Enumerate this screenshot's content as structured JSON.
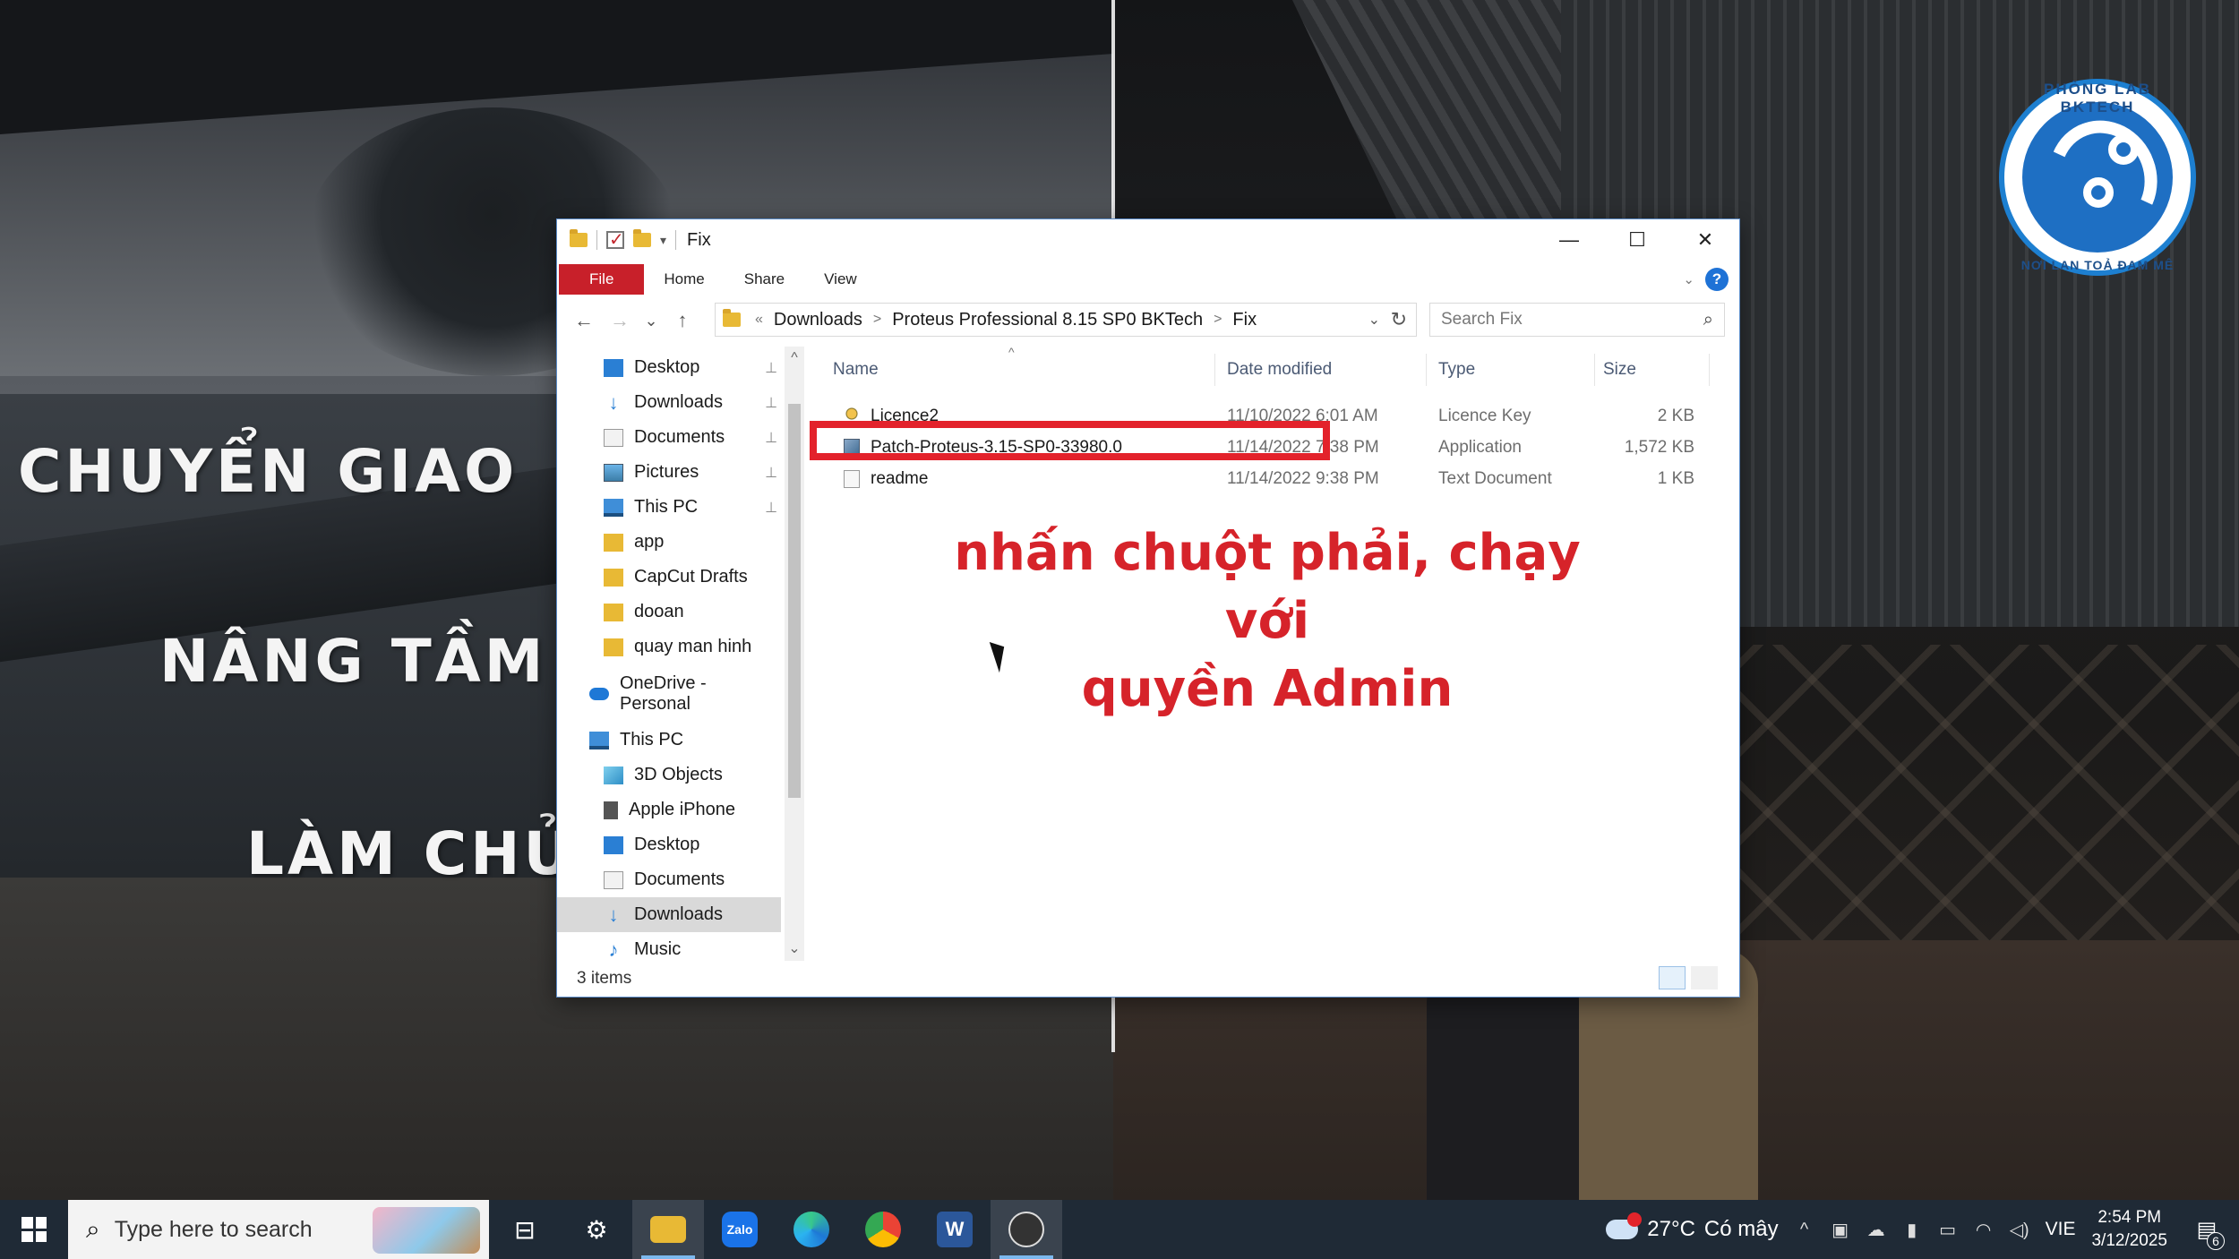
{
  "background": {
    "overlay_lines": [
      "CHUYỂN GIAO",
      "NÂNG TẦM",
      "LÀM CHỦ"
    ]
  },
  "logo": {
    "text_top": "PHÒNG LAB BKTECH",
    "text_bottom": "NƠI LAN TOẢ ĐAM MÊ"
  },
  "window": {
    "title": "Fix",
    "controls": {
      "minimize": "—",
      "maximize": "☐",
      "close": "✕"
    },
    "ribbon_tabs": [
      "File",
      "Home",
      "Share",
      "View"
    ],
    "nav": {
      "back": "←",
      "forward": "→",
      "recent": "⌄",
      "up": "↑"
    },
    "address": {
      "overflow": "«",
      "crumbs": [
        "Downloads",
        "Proteus Professional 8.15 SP0 BKTech",
        "Fix"
      ],
      "separator": ">"
    },
    "search": {
      "placeholder": "Search Fix"
    },
    "nav_pane": [
      {
        "label": "Desktop",
        "icon": "desktop-icon",
        "pinned": true
      },
      {
        "label": "Downloads",
        "icon": "downloads-icon",
        "pinned": true
      },
      {
        "label": "Documents",
        "icon": "documents-icon",
        "pinned": true
      },
      {
        "label": "Pictures",
        "icon": "pictures-icon",
        "pinned": true
      },
      {
        "label": "This PC",
        "icon": "this-pc-icon",
        "pinned": true
      },
      {
        "label": "app",
        "icon": "folder-icon",
        "pinned": false
      },
      {
        "label": "CapCut Drafts",
        "icon": "folder-icon",
        "pinned": false
      },
      {
        "label": "dooan",
        "icon": "folder-icon",
        "pinned": false
      },
      {
        "label": "quay man hinh",
        "icon": "folder-icon",
        "pinned": false
      },
      {
        "label": "OneDrive - Personal",
        "icon": "onedrive-icon",
        "pinned": false
      },
      {
        "label": "This PC",
        "icon": "this-pc-icon",
        "pinned": false
      },
      {
        "label": "3D Objects",
        "icon": "3d-objects-icon",
        "pinned": false
      },
      {
        "label": "Apple iPhone",
        "icon": "iphone-icon",
        "pinned": false
      },
      {
        "label": "Desktop",
        "icon": "desktop-icon",
        "pinned": false
      },
      {
        "label": "Documents",
        "icon": "documents-icon",
        "pinned": false
      },
      {
        "label": "Downloads",
        "icon": "downloads-icon",
        "pinned": false,
        "selected": true
      },
      {
        "label": "Music",
        "icon": "music-icon",
        "pinned": false
      }
    ],
    "columns": [
      "Name",
      "Date modified",
      "Type",
      "Size"
    ],
    "files": [
      {
        "name": "Licence2",
        "date": "11/10/2022 6:01 AM",
        "type": "Licence Key",
        "size": "2 KB",
        "icon": "licence-key-icon"
      },
      {
        "name": "Patch-Proteus-3.15-SP0-33980.0",
        "date": "11/14/2022 7:38 PM",
        "type": "Application",
        "size": "1,572 KB",
        "icon": "application-icon"
      },
      {
        "name": "readme",
        "date": "11/14/2022 9:38 PM",
        "type": "Text Document",
        "size": "1 KB",
        "icon": "text-document-icon"
      }
    ],
    "status": "3 items"
  },
  "annotation": {
    "line1": "nhấn chuột phải, chạy với",
    "line2": "quyền Admin",
    "color": "#d6232a"
  },
  "taskbar": {
    "search_placeholder": "Type here to search",
    "apps": [
      "task-view",
      "settings",
      "file-explorer",
      "zalo",
      "edge",
      "chrome",
      "word",
      "obs"
    ],
    "zalo_label": "Zalo",
    "word_label": "W",
    "weather": {
      "temp": "27°C",
      "desc": "Có mây"
    },
    "language": "VIE",
    "time": "2:54 PM",
    "date": "3/12/2025",
    "notifications": "6"
  }
}
